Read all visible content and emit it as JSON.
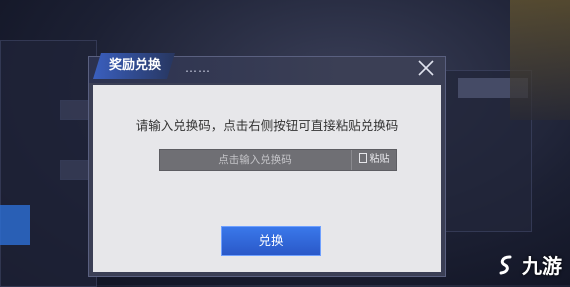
{
  "dialog": {
    "title": "奖励兑换",
    "title_suffix": "……",
    "prompt": "请输入兑换码，点击右侧按钮可直接粘贴兑换码",
    "code_input": {
      "placeholder": "点击输入兑换码",
      "value": ""
    },
    "paste_label": "粘贴",
    "redeem_label": "兑换"
  },
  "watermark": {
    "text": "九游"
  },
  "colors": {
    "accent": "#2f63d8",
    "dialog_bg": "#3b3f55",
    "content_bg": "#e7e7ea"
  }
}
